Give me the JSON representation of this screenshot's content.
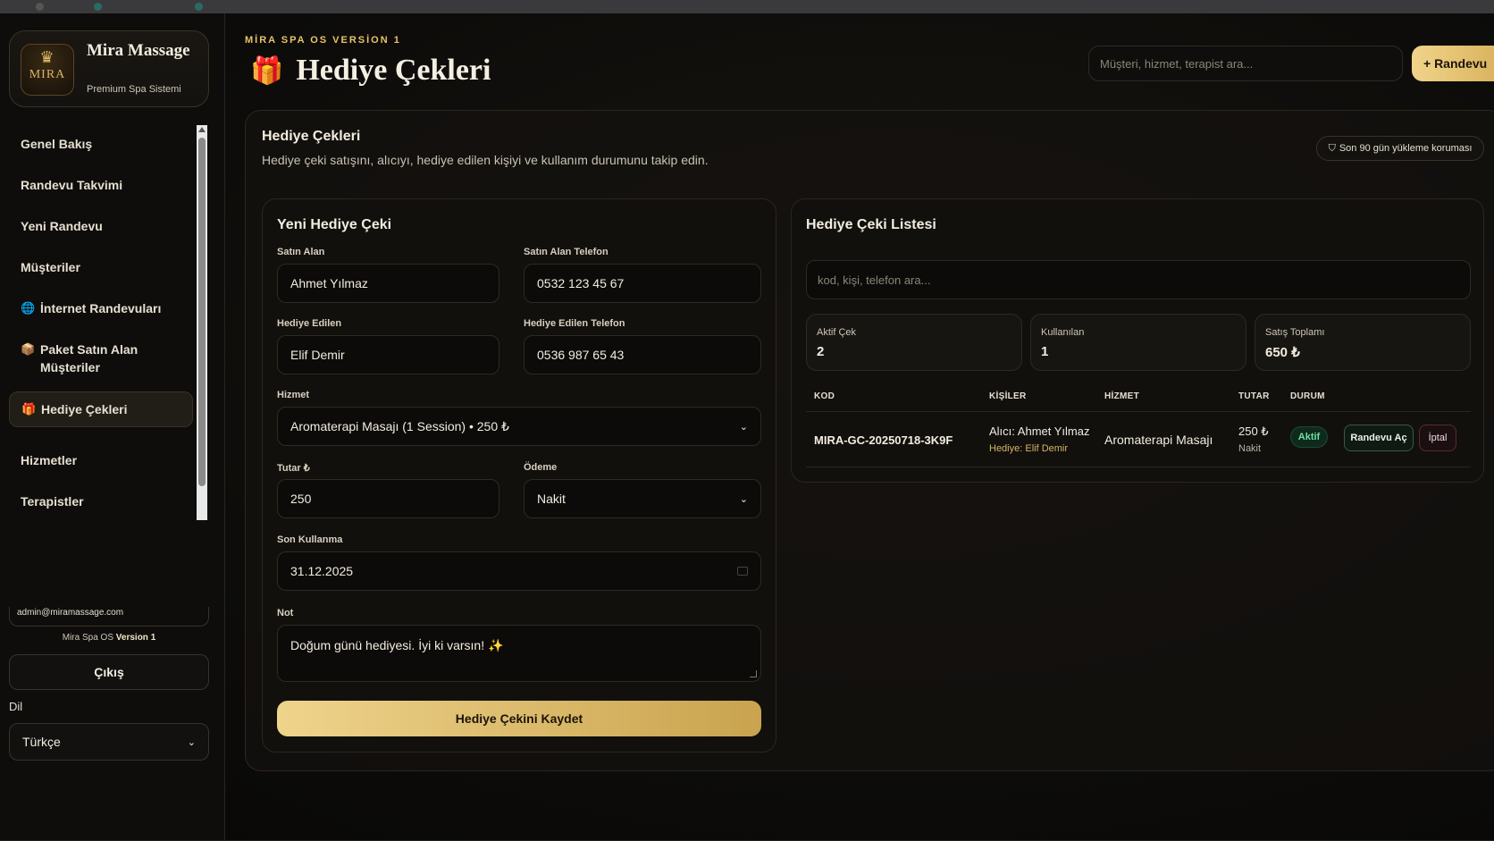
{
  "sidebar": {
    "brand_name": "Mira Massage",
    "brand_sub": "Premium Spa Sistemi",
    "logo_text": "MIRA",
    "items": [
      {
        "label": "Genel Bakış",
        "icon": ""
      },
      {
        "label": "Randevu Takvimi",
        "icon": ""
      },
      {
        "label": "Yeni Randevu",
        "icon": ""
      },
      {
        "label": "Müşteriler",
        "icon": ""
      },
      {
        "label": "İnternet Randevuları",
        "icon": "🌐"
      },
      {
        "label": "Paket Satın Alan Müşteriler",
        "icon": "📦"
      },
      {
        "label": "Hediye Çekleri",
        "icon": "🎁"
      },
      {
        "label": "Hizmetler",
        "icon": ""
      },
      {
        "label": "Terapistler",
        "icon": ""
      }
    ],
    "email": "admin@miramassage.com",
    "version_prefix": "Mira Spa OS",
    "version_bold": "Version 1",
    "logout_label": "Çıkış",
    "lang_label": "Dil",
    "lang_value": "Türkçe"
  },
  "header": {
    "kicker": "MİRA SPA OS VERSİON 1",
    "title": "Hediye Çekleri",
    "title_icon": "🎁",
    "search_placeholder": "Müşteri, hizmet, terapist ara...",
    "new_button": "+ Randevu"
  },
  "panel": {
    "title": "Hediye Çekleri",
    "description": "Hediye çeki satışını, alıcıyı, hediye edilen kişiyi ve kullanım durumunu takip edin.",
    "protect_badge": "Son 90 gün yükleme koruması"
  },
  "form": {
    "title": "Yeni Hediye Çeki",
    "buyer_label": "Satın Alan",
    "buyer_value": "Ahmet Yılmaz",
    "buyer_phone_label": "Satın Alan Telefon",
    "buyer_phone_value": "0532 123 45 67",
    "recipient_label": "Hediye Edilen",
    "recipient_value": "Elif Demir",
    "recipient_phone_label": "Hediye Edilen Telefon",
    "recipient_phone_value": "0536 987 65 43",
    "service_label": "Hizmet",
    "service_value": "Aromaterapi Masajı (1 Session) • 250 ₺",
    "amount_label": "Tutar ₺",
    "amount_value": "250",
    "payment_label": "Ödeme",
    "payment_value": "Nakit",
    "expiry_label": "Son Kullanma",
    "expiry_value": "31.12.2025",
    "note_label": "Not",
    "note_value": "Doğum günü hediyesi. İyi ki varsın! ✨",
    "save_button": "Hediye Çekini Kaydet"
  },
  "list": {
    "title": "Hediye Çeki Listesi",
    "search_placeholder": "kod, kişi, telefon ara...",
    "stats": [
      {
        "label": "Aktif Çek",
        "value": "2"
      },
      {
        "label": "Kullanılan",
        "value": "1"
      },
      {
        "label": "Satış Toplamı",
        "value": "650 ₺"
      }
    ],
    "columns": [
      "KOD",
      "KİŞİLER",
      "HİZMET",
      "TUTAR",
      "DURUM"
    ],
    "rows": [
      {
        "code": "MIRA-GC-20250718-3K9F",
        "buyer": "Alıcı: Ahmet Yılmaz",
        "recipient": "Hediye: Elif Demir",
        "service": "Aromaterapi Masajı",
        "amount": "250 ₺",
        "payment": "Nakit",
        "status": "Aktif",
        "open_button": "Randevu Aç",
        "cancel_button": "İptal"
      }
    ]
  }
}
